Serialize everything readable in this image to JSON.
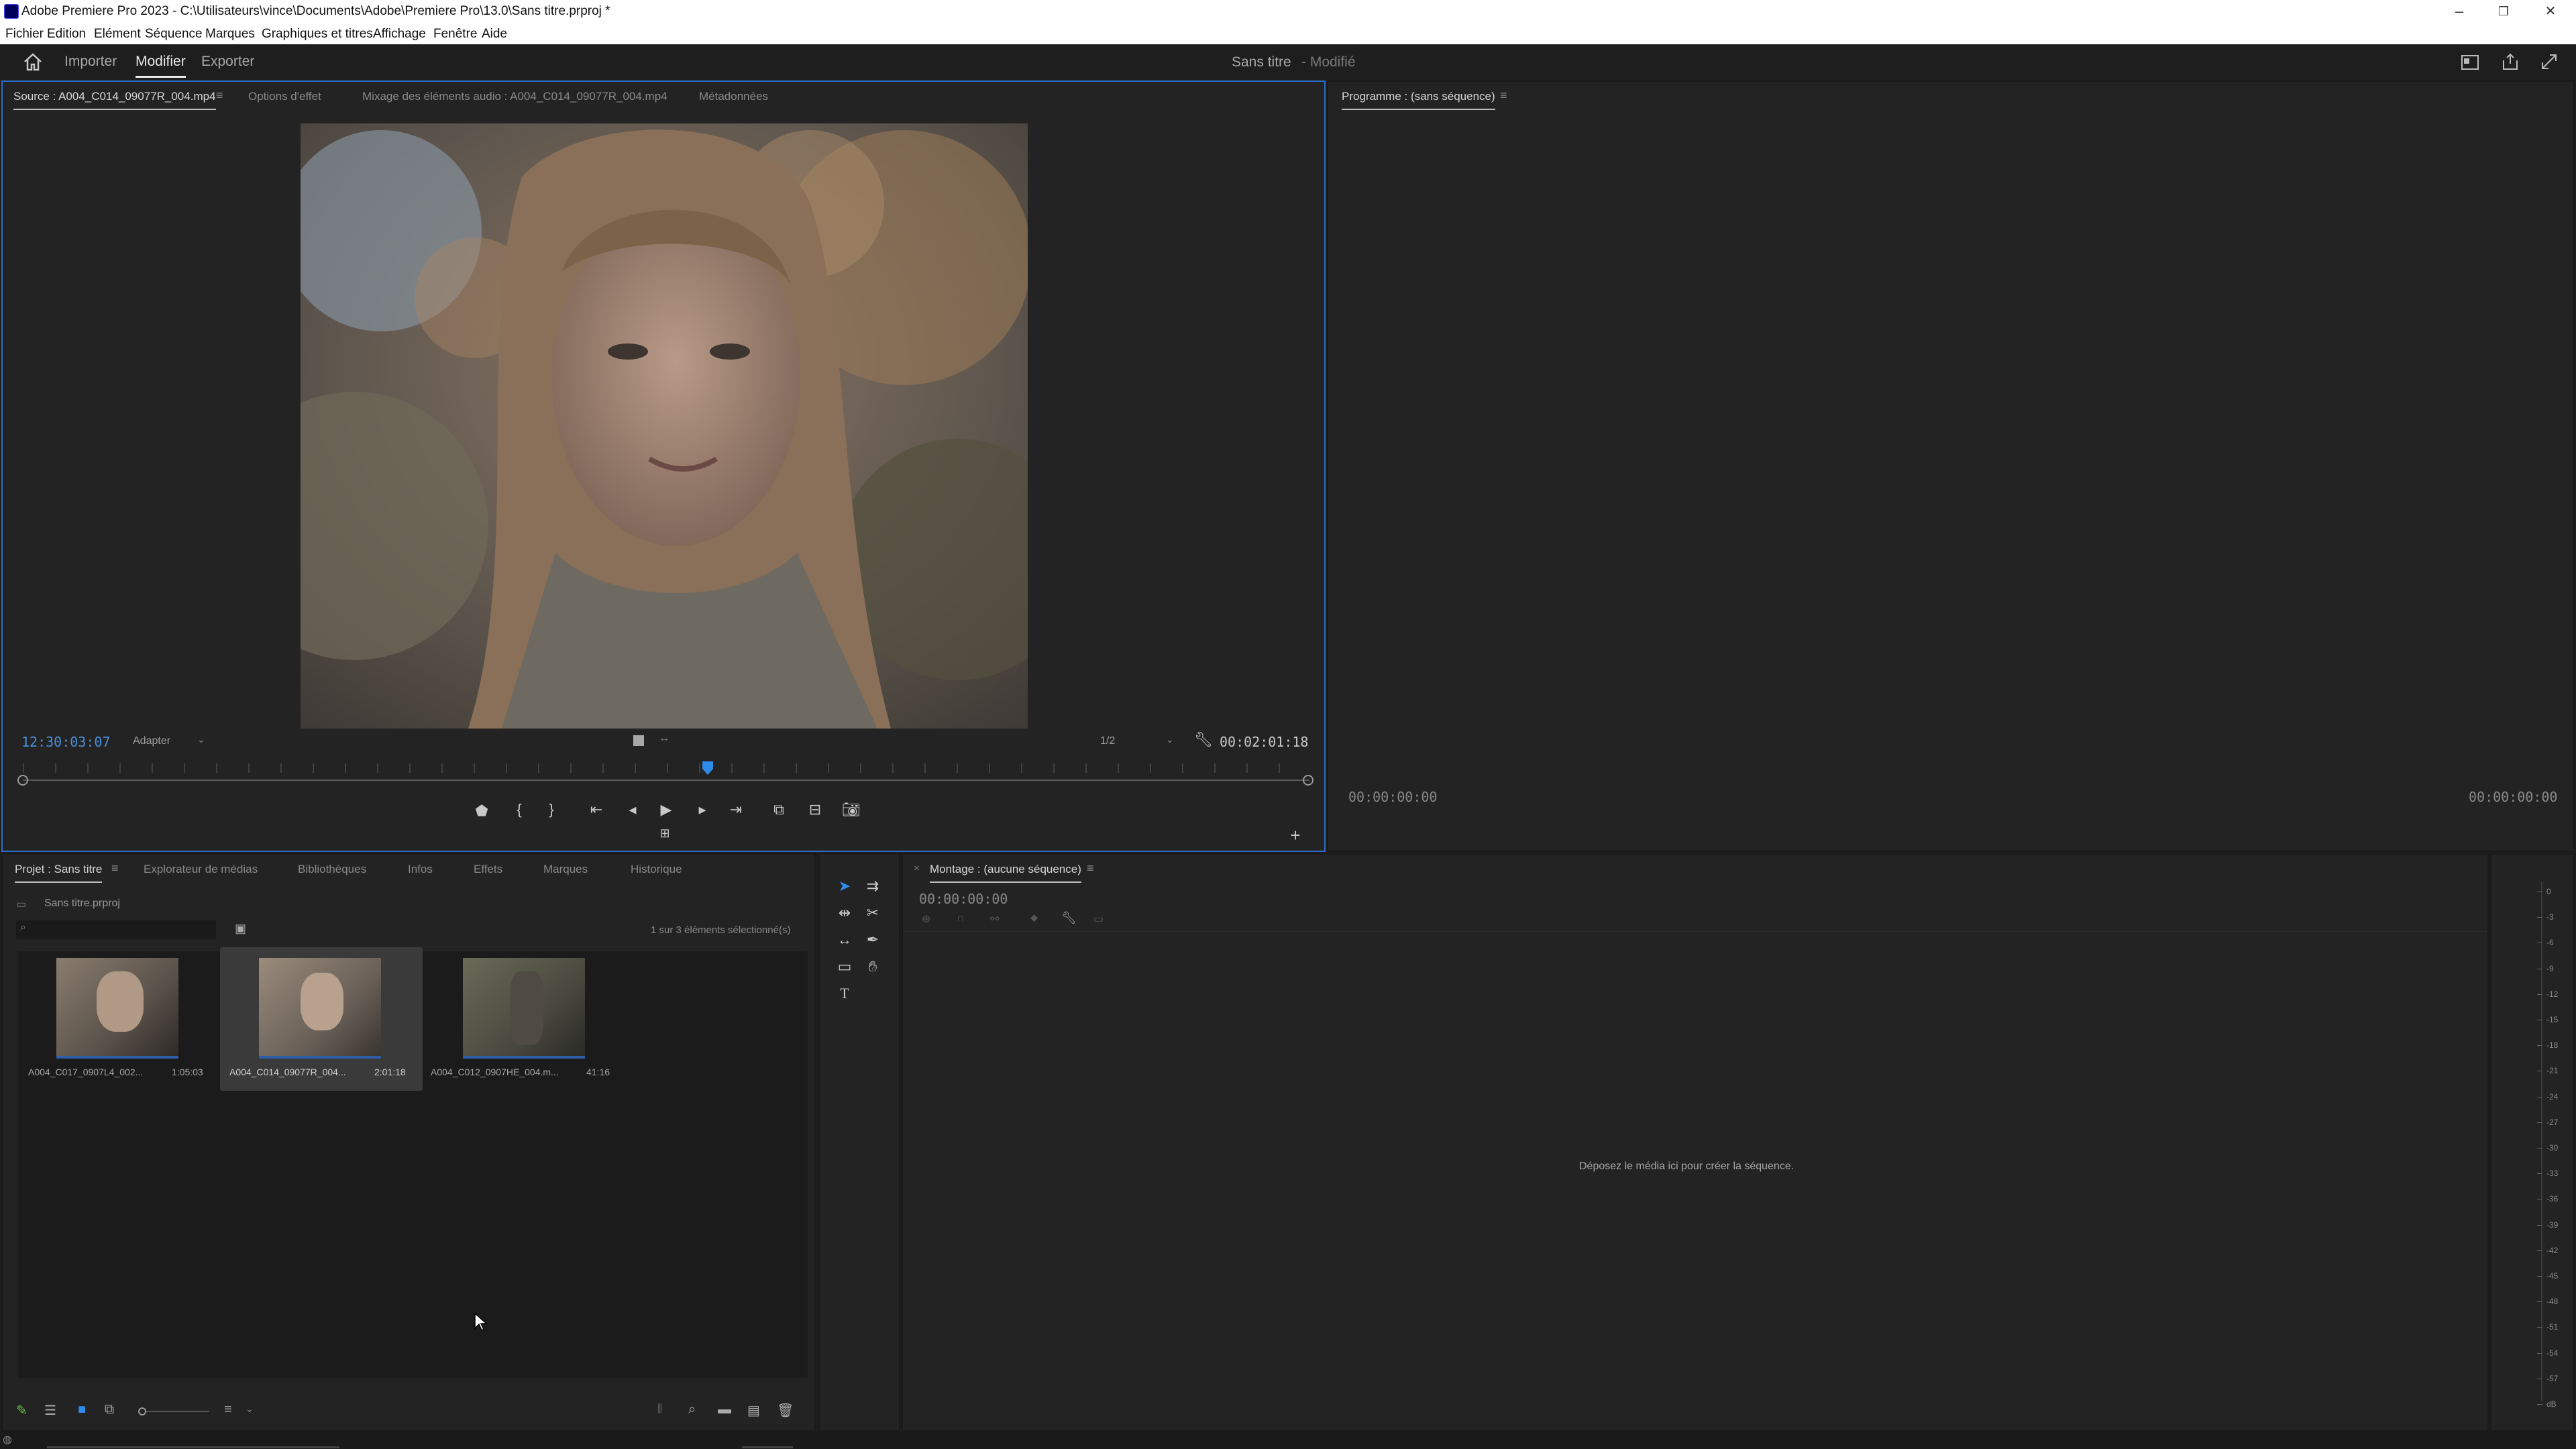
{
  "window": {
    "title": "Adobe Premiere Pro 2023 - C:\\Utilisateurs\\vince\\Documents\\Adobe\\Premiere Pro\\13.0\\Sans titre.prproj *",
    "minimize": "–",
    "restore": "❐",
    "close": "✕"
  },
  "menu": [
    "Fichier",
    "Edition",
    "Elément",
    "Séquence",
    "Marques",
    "Graphiques et titres",
    "Affichage",
    "Fenêtre",
    "Aide"
  ],
  "header": {
    "tabs": [
      "Importer",
      "Modifier",
      "Exporter"
    ],
    "project_name": "Sans titre",
    "project_status": "- Modifié"
  },
  "source_panel": {
    "tabs": [
      "Source : A004_C014_09077R_004.mp4",
      "Options d'effet",
      "Mixage des éléments audio : A004_C014_09077R_004.mp4",
      "Métadonnées"
    ],
    "timecode_in": "12:30:03:07",
    "fit": "Adapter",
    "resolution": "1/2",
    "duration": "00:02:01:18"
  },
  "program_panel": {
    "title": "Programme : (sans séquence)",
    "timecode_left": "00:00:00:00",
    "timecode_right": "00:00:00:00"
  },
  "project_panel": {
    "tabs": [
      "Projet : Sans titre",
      "Explorateur de médias",
      "Bibliothèques",
      "Infos",
      "Effets",
      "Marques",
      "Historique"
    ],
    "bin": "Sans titre.prproj",
    "selection_info": "1 sur 3 éléments sélectionné(s)",
    "clips": [
      {
        "name": "A004_C017_0907L4_002...",
        "duration": "1:05:03"
      },
      {
        "name": "A004_C014_09077R_004...",
        "duration": "2:01:18"
      },
      {
        "name": "A004_C012_0907HE_004.m...",
        "duration": "41:16"
      }
    ]
  },
  "timeline_panel": {
    "title": "Montage : (aucune séquence)",
    "timecode": "00:00:00:00",
    "drop_hint": "Déposez le média ici pour créer la séquence."
  },
  "audio_meter": {
    "ticks": [
      "0",
      "-3",
      "-6",
      "-9",
      "-12",
      "-15",
      "-18",
      "-21",
      "-24",
      "-27",
      "-30",
      "-33",
      "-36",
      "-39",
      "-42",
      "-45",
      "-48",
      "-51",
      "-54",
      "-57",
      "dB"
    ]
  },
  "colors": {
    "accent_blue": "#2d8ceb",
    "timecode_blue": "#4a90d9",
    "panel_bg": "#232323",
    "selection": "#3a3a3a"
  }
}
